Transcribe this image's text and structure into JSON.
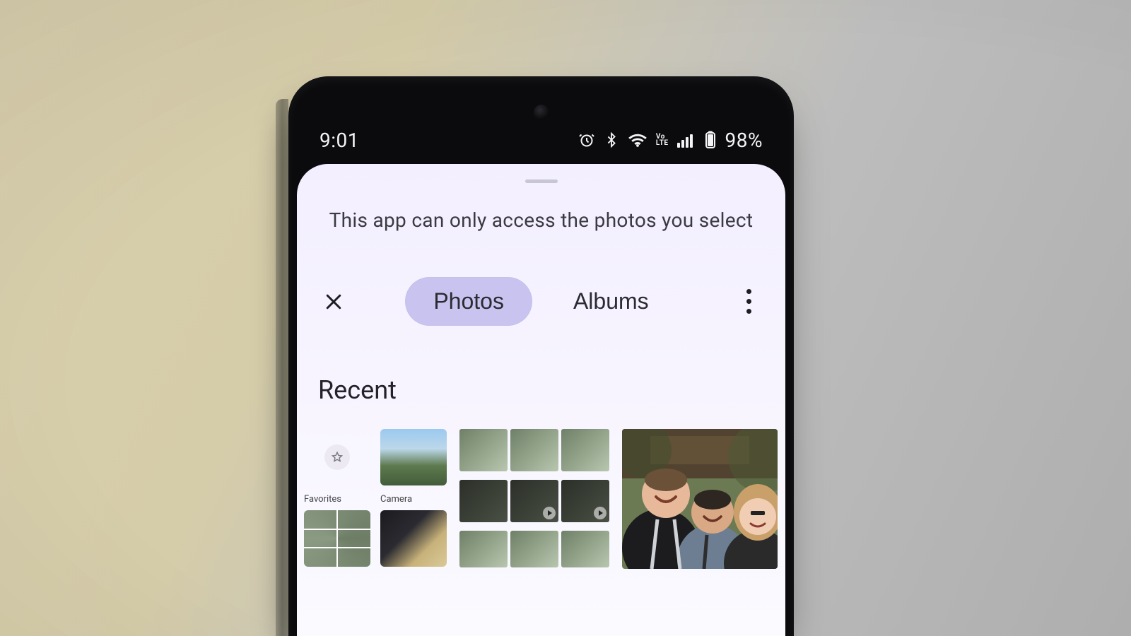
{
  "statusbar": {
    "time": "9:01",
    "battery_text": "98%",
    "volte_label": "Vo\nLTE"
  },
  "sheet": {
    "permission_message": "This app can only access the photos you select",
    "tabs": {
      "photos": "Photos",
      "albums": "Albums"
    },
    "section_heading": "Recent",
    "favorites_label": "Favorites",
    "camera_label": "Camera"
  }
}
